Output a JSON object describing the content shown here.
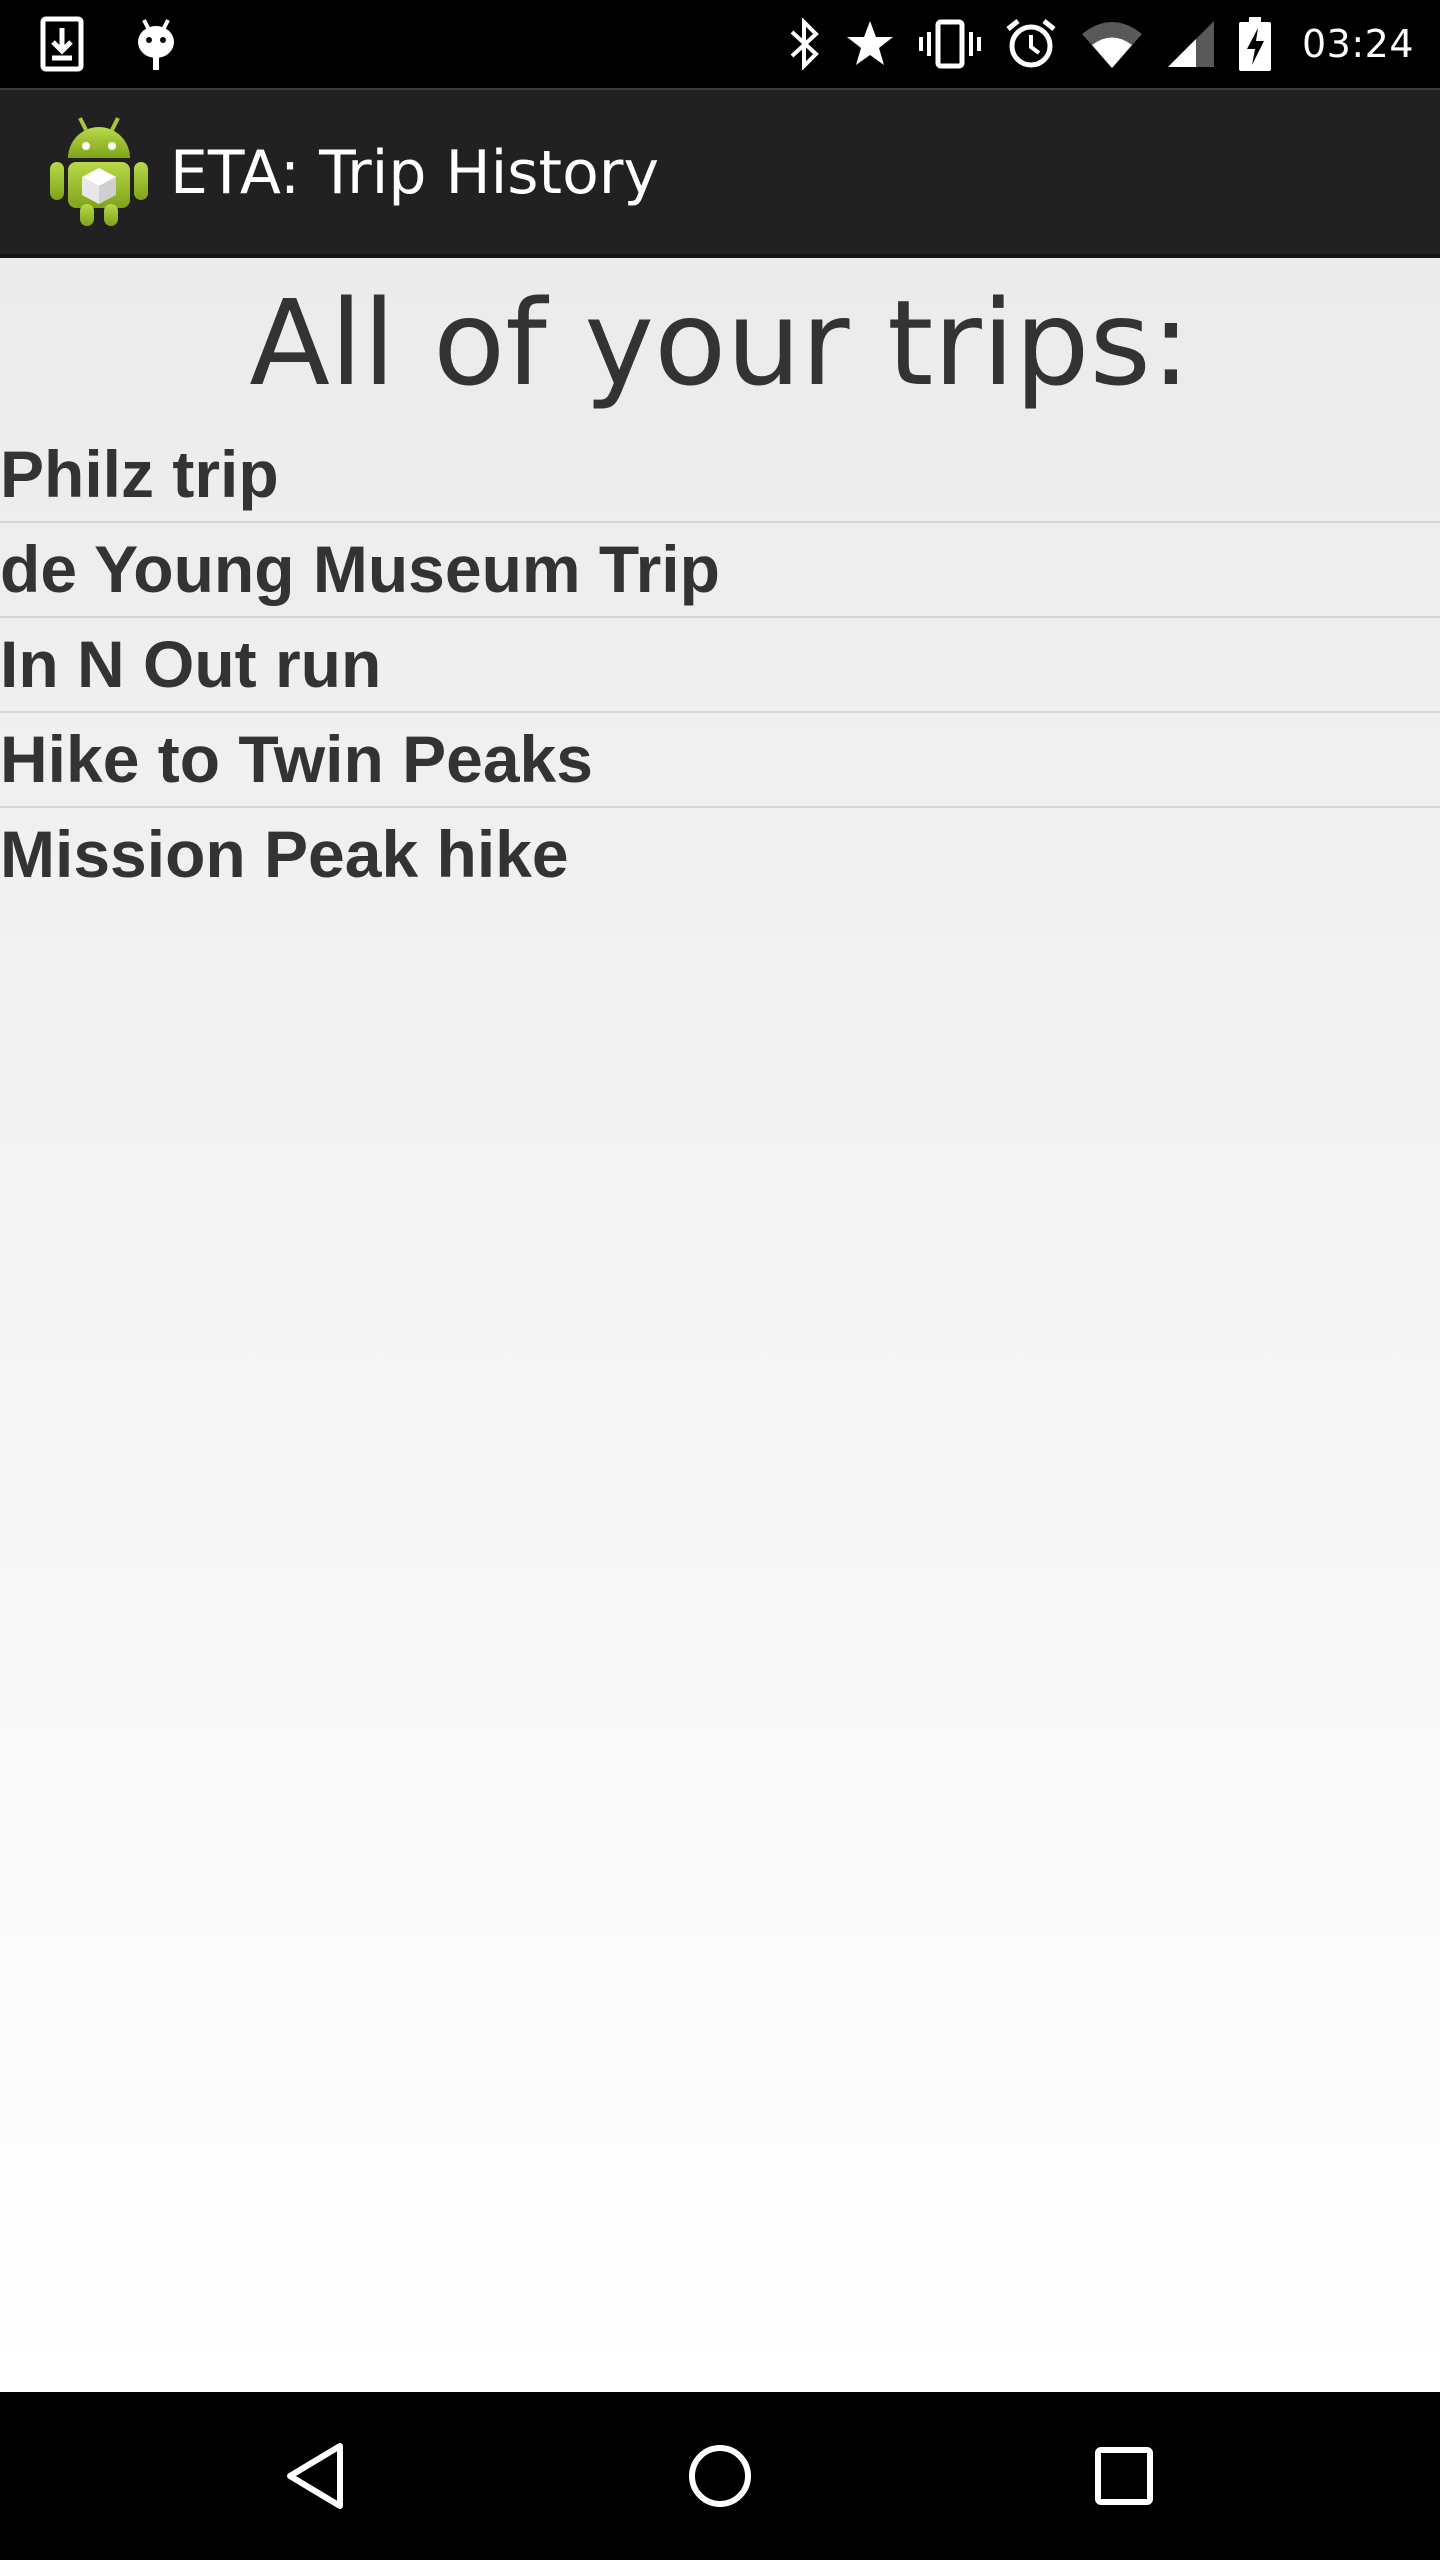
{
  "status_bar": {
    "time": "03:24",
    "left_icons": [
      "download-icon",
      "android-debug-icon"
    ],
    "right_icons": [
      "bluetooth-icon",
      "star-icon",
      "vibrate-icon",
      "alarm-icon",
      "wifi-icon",
      "signal-icon",
      "battery-charging-icon"
    ]
  },
  "action_bar": {
    "title": "ETA: Trip History",
    "icon": "android-app-icon",
    "background": "#212121"
  },
  "main": {
    "heading": "All of your trips:",
    "trips": [
      {
        "name": "Philz trip"
      },
      {
        "name": "de Young Museum Trip"
      },
      {
        "name": "In N Out run"
      },
      {
        "name": "Hike to Twin Peaks"
      },
      {
        "name": "Mission Peak hike"
      }
    ]
  },
  "nav_bar": {
    "buttons": [
      "back-icon",
      "home-icon",
      "recents-icon"
    ]
  }
}
